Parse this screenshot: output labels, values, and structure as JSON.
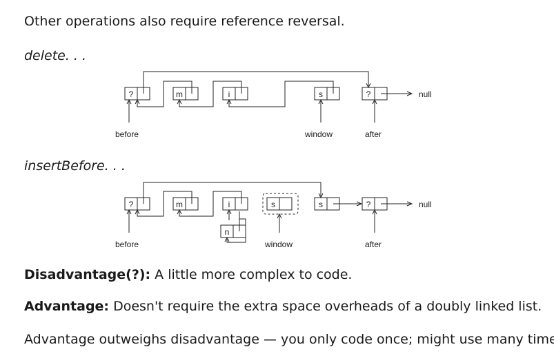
{
  "heading": "Other operations also require reference reversal.",
  "delete_label": "delete. . .",
  "insert_label": "insertBefore. . .",
  "delete_diagram": {
    "nodes": [
      "?",
      "m",
      "i",
      "s",
      "?"
    ],
    "null_label": "null",
    "pointers": {
      "before": "before",
      "window": "window",
      "after": "after"
    }
  },
  "insert_diagram": {
    "nodes": [
      "?",
      "m",
      "i",
      "s",
      "s",
      "?",
      "n"
    ],
    "null_label": "null",
    "pointers": {
      "before": "before",
      "window": "window",
      "after": "after"
    }
  },
  "disadvantage": {
    "label": "Disadvantage(?):",
    "text": " A little more complex to code."
  },
  "advantage": {
    "label": "Advantage:",
    "text": " Doesn't require the extra space overheads of a doubly linked list."
  },
  "conclusion": "Advantage outweighs disadvantage — you only code once; might use many times!"
}
